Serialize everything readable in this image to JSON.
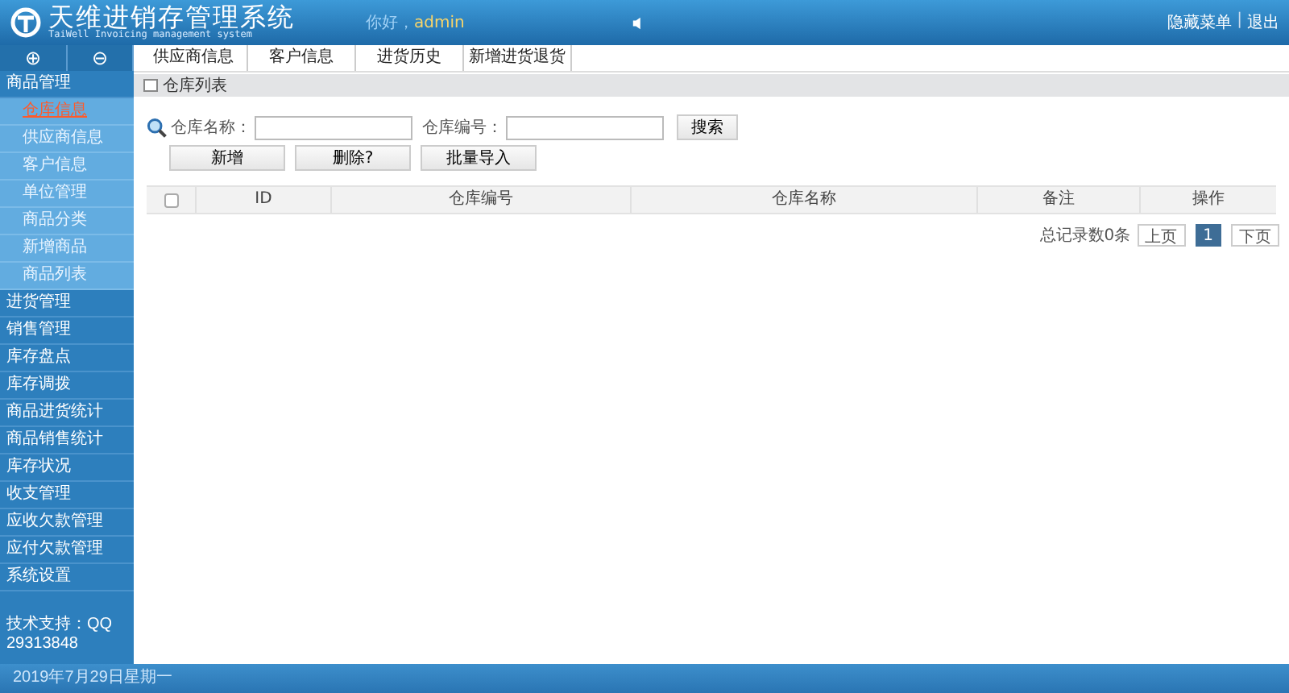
{
  "header": {
    "title": "天维进销存管理系统",
    "subtitle": "TaiWell Invoicing management system",
    "greeting": "你好，",
    "user": "admin",
    "links": [
      "隐藏菜单",
      "退出"
    ],
    "separator": "|"
  },
  "sidebar": {
    "tools": [
      "⊕",
      "⊖"
    ],
    "menu": [
      {
        "label": "商品管理",
        "children": [
          {
            "label": "仓库信息",
            "selected": true
          },
          {
            "label": "供应商信息",
            "selected": false
          },
          {
            "label": "客户信息",
            "selected": false
          },
          {
            "label": "单位管理",
            "selected": false
          },
          {
            "label": "商品分类",
            "selected": false
          },
          {
            "label": "新增商品",
            "selected": false
          },
          {
            "label": "商品列表",
            "selected": false
          }
        ]
      },
      {
        "label": "进货管理"
      },
      {
        "label": "销售管理"
      },
      {
        "label": "库存盘点"
      },
      {
        "label": "库存调拨"
      },
      {
        "label": "商品进货统计"
      },
      {
        "label": "商品销售统计"
      },
      {
        "label": "库存状况"
      },
      {
        "label": "收支管理"
      },
      {
        "label": "应收欠款管理"
      },
      {
        "label": "应付欠款管理"
      },
      {
        "label": "系统设置"
      }
    ],
    "support": "技术支持：QQ 29313848"
  },
  "tabs": [
    "供应商信息",
    "客户信息",
    "进货历史",
    "新增进货退货"
  ],
  "panel": {
    "title": "仓库列表",
    "search": {
      "fields": [
        {
          "label": "仓库名称："
        },
        {
          "label": "仓库编号："
        }
      ],
      "button": "搜索"
    },
    "actions": [
      "新增",
      "删除?",
      "批量导入"
    ],
    "table": {
      "select_all": {
        "checked": false
      },
      "columns": [
        "ID",
        "仓库编号",
        "仓库名称",
        "备注",
        "操作"
      ]
    },
    "pagination": {
      "total": "总记录数0条",
      "prev": "上页",
      "pages": [
        {
          "label": "1",
          "selected": true
        }
      ],
      "next": "下页"
    }
  },
  "status_bar": {
    "date": "2019年7月29日星期一"
  }
}
